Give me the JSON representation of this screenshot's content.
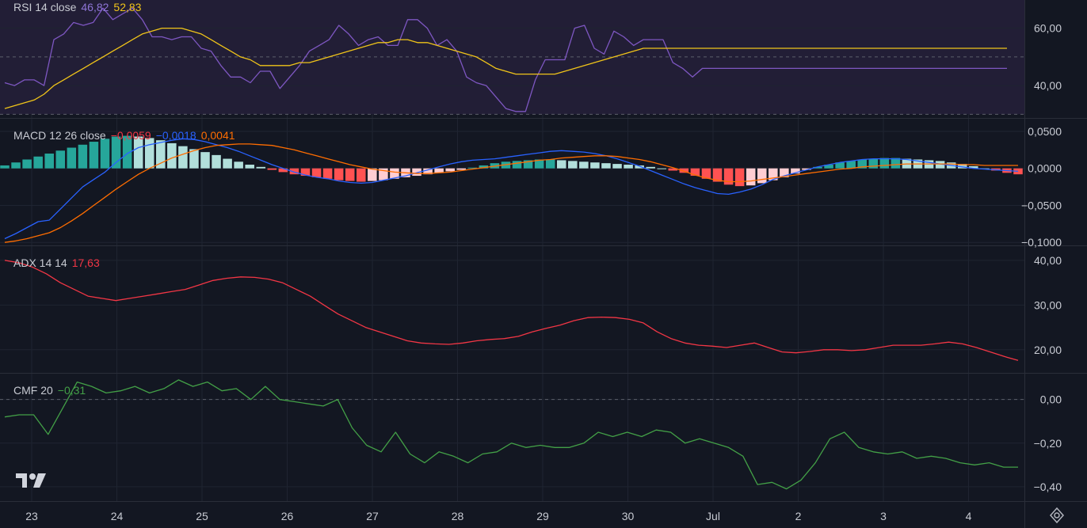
{
  "colors": {
    "background": "#131722",
    "grid": "#1f2431",
    "divider": "#2a2e39",
    "rsi_band": "#221e36",
    "rsi": "#7e57c2",
    "rsi_ma": "#f0c419",
    "macd": "#2962ff",
    "signal": "#ff6d00",
    "hist_pos_strong": "#26a69a",
    "hist_pos_weak": "#b2dfdb",
    "hist_neg_strong": "#ff5252",
    "hist_neg_weak": "#ffcdd2",
    "adx": "#f23645",
    "cmf": "#43a047",
    "dashed_level": "#5d606b"
  },
  "panes": {
    "rsi": {
      "name": "RSI 14 close",
      "v1": "46,82",
      "v2": "52,83"
    },
    "macd": {
      "name": "MACD 12 26 close",
      "v1": "−0,0059",
      "v2": "−0,0018",
      "v3": "0,0041"
    },
    "adx": {
      "name": "ADX 14 14",
      "v1": "17,63"
    },
    "cmf": {
      "name": "CMF 20",
      "v1": "−0,31"
    }
  },
  "icons": {
    "logo": "tradingview-logo",
    "settings": "gear-icon"
  },
  "chart_data": [
    {
      "type": "line",
      "pane": "RSI 14 close",
      "ylim": [
        29,
        69
      ],
      "bands": [
        30,
        70
      ],
      "midline": 50,
      "yticks": [
        40,
        60
      ],
      "ytick_labels": [
        "40,00",
        "60,00"
      ],
      "x": [
        0,
        1,
        2,
        3,
        4,
        5,
        6,
        7,
        8,
        9,
        10,
        11,
        12,
        13,
        14,
        15,
        16,
        17,
        18,
        19,
        20,
        21,
        22,
        23,
        24,
        25,
        26,
        27,
        28,
        29,
        30,
        31,
        32,
        33,
        34,
        35,
        36,
        37,
        38,
        39,
        40,
        41,
        42,
        43,
        44,
        45,
        46,
        47,
        48,
        49,
        50,
        51,
        52,
        53,
        54,
        55,
        56,
        57,
        58,
        59,
        60,
        61,
        62,
        63,
        64,
        65,
        66,
        67,
        68,
        69,
        70,
        71,
        72,
        73,
        74,
        75,
        76,
        77,
        78,
        79,
        80,
        81,
        82,
        83,
        84,
        85,
        86,
        87,
        88,
        89,
        90,
        91,
        92,
        93,
        94,
        95,
        96,
        97,
        98,
        99,
        100,
        101,
        102,
        103,
        104,
        105,
        106,
        107,
        108,
        109,
        110,
        111,
        112,
        113,
        114,
        115,
        116,
        117,
        118
      ],
      "series": [
        {
          "name": "RSI",
          "color": "#7e57c2",
          "values": [
            41,
            40,
            42,
            42,
            40,
            56,
            58,
            62,
            61,
            62,
            67,
            63,
            65,
            67,
            63,
            57,
            57,
            56,
            57,
            57,
            53,
            52,
            47,
            43,
            43,
            41,
            45,
            45,
            39,
            43,
            47,
            52,
            54,
            56,
            61,
            58,
            54,
            56,
            57,
            54,
            54,
            63,
            63,
            60,
            54,
            56,
            52,
            43,
            41,
            40,
            36,
            32,
            31,
            31,
            42,
            49,
            49,
            49,
            60,
            61,
            53,
            51,
            59,
            57,
            54,
            56,
            56,
            56,
            48,
            46,
            43,
            46,
            46,
            46,
            46,
            46,
            46,
            46,
            46,
            46,
            46,
            46,
            46,
            46,
            46,
            46,
            46,
            46,
            46,
            46,
            46,
            46,
            46,
            46,
            46,
            46,
            46,
            46,
            46,
            46,
            46,
            46,
            46,
            46,
            46,
            46,
            46,
            46,
            46,
            46,
            46,
            46,
            46,
            46,
            46,
            46,
            46,
            46,
            46
          ]
        },
        {
          "name": "RSI-based MA",
          "color": "#f0c419",
          "values": [
            32,
            33,
            34,
            35,
            37,
            40,
            42,
            44,
            46,
            48,
            50,
            52,
            54,
            56,
            58,
            59,
            60,
            60,
            60,
            59,
            58,
            56,
            54,
            52,
            50,
            49,
            47,
            47,
            47,
            47,
            48,
            48,
            49,
            50,
            51,
            52,
            53,
            54,
            55,
            55,
            56,
            56,
            55,
            55,
            54,
            53,
            52,
            51,
            50,
            48,
            46,
            45,
            44,
            44,
            44,
            44,
            44,
            45,
            46,
            47,
            48,
            49,
            50,
            51,
            52,
            53,
            53,
            53,
            53,
            53,
            53,
            53,
            53,
            53,
            53,
            53,
            53,
            53,
            53,
            53,
            53,
            53,
            53,
            53,
            53,
            53,
            53,
            53,
            53,
            53,
            53,
            53,
            53,
            53,
            53,
            53,
            53,
            53,
            53,
            53,
            53,
            53,
            53,
            53,
            53,
            53,
            53,
            53,
            53,
            53,
            53,
            53,
            53,
            53,
            53,
            53,
            53,
            53,
            53
          ]
        }
      ]
    },
    {
      "type": "bar",
      "pane": "MACD 12 26 close",
      "ylim": [
        -0.103,
        0.066
      ],
      "yticks": [
        0.05,
        0,
        -0.05,
        -0.1
      ],
      "ytick_labels": [
        "0,0500",
        "0,0000",
        "−0,0500",
        "−0,1000"
      ],
      "histogram": [
        0.004,
        0.008,
        0.012,
        0.016,
        0.02,
        0.024,
        0.028,
        0.032,
        0.036,
        0.04,
        0.043,
        0.044,
        0.043,
        0.041,
        0.038,
        0.034,
        0.03,
        0.026,
        0.022,
        0.018,
        0.013,
        0.009,
        0.005,
        0.002,
        -0.002,
        -0.005,
        -0.008,
        -0.01,
        -0.012,
        -0.014,
        -0.016,
        -0.017,
        -0.018,
        -0.017,
        -0.016,
        -0.014,
        -0.012,
        -0.01,
        -0.008,
        -0.006,
        -0.004,
        -0.002,
        0.001,
        0.004,
        0.007,
        0.009,
        0.01,
        0.011,
        0.012,
        0.012,
        0.011,
        0.01,
        0.009,
        0.008,
        0.007,
        0.006,
        0.005,
        0.004,
        0.002,
        0.0,
        -0.003,
        -0.006,
        -0.01,
        -0.014,
        -0.018,
        -0.022,
        -0.024,
        -0.023,
        -0.02,
        -0.016,
        -0.012,
        -0.007,
        -0.002,
        0.002,
        0.005,
        0.008,
        0.01,
        0.012,
        0.013,
        0.014,
        0.014,
        0.013,
        0.012,
        0.011,
        0.01,
        0.008,
        0.006,
        0.003,
        0.0,
        -0.003,
        -0.006,
        -0.008
      ],
      "series": [
        {
          "name": "MACD",
          "color": "#2962ff",
          "values": [
            -0.095,
            -0.088,
            -0.08,
            -0.072,
            -0.07,
            -0.055,
            -0.04,
            -0.025,
            -0.015,
            -0.005,
            0.008,
            0.02,
            0.028,
            0.032,
            0.035,
            0.038,
            0.04,
            0.039,
            0.036,
            0.032,
            0.028,
            0.023,
            0.017,
            0.011,
            0.005,
            0.0,
            -0.005,
            -0.009,
            -0.012,
            -0.014,
            -0.017,
            -0.019,
            -0.02,
            -0.019,
            -0.016,
            -0.013,
            -0.01,
            -0.006,
            -0.002,
            0.002,
            0.006,
            0.009,
            0.011,
            0.012,
            0.013,
            0.015,
            0.017,
            0.019,
            0.021,
            0.023,
            0.024,
            0.023,
            0.022,
            0.02,
            0.017,
            0.013,
            0.008,
            0.003,
            -0.003,
            -0.009,
            -0.015,
            -0.021,
            -0.026,
            -0.03,
            -0.034,
            -0.035,
            -0.032,
            -0.028,
            -0.022,
            -0.015,
            -0.01,
            -0.006,
            -0.002,
            0.002,
            0.005,
            0.008,
            0.01,
            0.012,
            0.013,
            0.013,
            0.013,
            0.012,
            0.01,
            0.008,
            0.006,
            0.004,
            0.002,
            0.0,
            -0.001,
            -0.002,
            -0.003,
            -0.004
          ]
        },
        {
          "name": "Signal",
          "color": "#ff6d00",
          "values": [
            -0.1,
            -0.098,
            -0.095,
            -0.091,
            -0.087,
            -0.08,
            -0.071,
            -0.061,
            -0.05,
            -0.039,
            -0.028,
            -0.018,
            -0.008,
            0.0,
            0.007,
            0.014,
            0.019,
            0.024,
            0.028,
            0.031,
            0.032,
            0.033,
            0.033,
            0.032,
            0.031,
            0.028,
            0.025,
            0.021,
            0.017,
            0.013,
            0.009,
            0.005,
            0.002,
            -0.001,
            -0.003,
            -0.005,
            -0.006,
            -0.007,
            -0.007,
            -0.006,
            -0.005,
            -0.003,
            -0.001,
            0.001,
            0.003,
            0.005,
            0.007,
            0.009,
            0.011,
            0.012,
            0.014,
            0.015,
            0.016,
            0.017,
            0.017,
            0.016,
            0.014,
            0.012,
            0.009,
            0.005,
            0.001,
            -0.004,
            -0.009,
            -0.013,
            -0.016,
            -0.018,
            -0.018,
            -0.017,
            -0.015,
            -0.013,
            -0.011,
            -0.009,
            -0.007,
            -0.005,
            -0.003,
            -0.001,
            0.0,
            0.002,
            0.003,
            0.004,
            0.005,
            0.006,
            0.006,
            0.006,
            0.006,
            0.006,
            0.005,
            0.005,
            0.004,
            0.004,
            0.004,
            0.004
          ]
        }
      ]
    },
    {
      "type": "line",
      "pane": "ADX 14 14",
      "ylim": [
        15,
        43
      ],
      "yticks": [
        20,
        30,
        40
      ],
      "ytick_labels": [
        "20,00",
        "30,00",
        "40,00"
      ],
      "series": [
        {
          "name": "ADX",
          "color": "#f23645",
          "values": [
            40,
            39.5,
            38.5,
            37,
            35,
            33.5,
            32,
            31.5,
            31,
            31.5,
            32,
            32.5,
            33,
            33.5,
            34.5,
            35.5,
            36,
            36.3,
            36.2,
            35.8,
            35,
            33.5,
            32,
            30,
            28,
            26.5,
            25,
            24,
            23,
            22,
            21.5,
            21.3,
            21.2,
            21.5,
            22,
            22.3,
            22.5,
            23,
            24,
            24.8,
            25.5,
            26.5,
            27.2,
            27.3,
            27.2,
            26.8,
            26,
            24,
            22.5,
            21.5,
            21,
            20.8,
            20.5,
            21,
            21.5,
            20.5,
            19.5,
            19.3,
            19.6,
            20,
            20,
            19.8,
            20,
            20.5,
            21,
            21,
            21,
            21.3,
            21.7,
            21.3,
            20.5,
            19.5,
            18.5,
            17.6
          ]
        }
      ]
    },
    {
      "type": "line",
      "pane": "CMF 20",
      "ylim": [
        -0.455,
        0.115
      ],
      "midline": 0,
      "yticks": [
        0,
        -0.2,
        -0.4
      ],
      "ytick_labels": [
        "0,00",
        "−0,20",
        "−0,40"
      ],
      "series": [
        {
          "name": "CMF",
          "color": "#43a047",
          "values": [
            -0.08,
            -0.07,
            -0.07,
            -0.16,
            -0.04,
            0.08,
            0.06,
            0.03,
            0.04,
            0.06,
            0.03,
            0.05,
            0.09,
            0.06,
            0.08,
            0.04,
            0.05,
            0.0,
            0.06,
            0.0,
            -0.01,
            -0.02,
            -0.03,
            0.0,
            -0.13,
            -0.21,
            -0.24,
            -0.15,
            -0.25,
            -0.29,
            -0.24,
            -0.26,
            -0.29,
            -0.25,
            -0.24,
            -0.2,
            -0.22,
            -0.21,
            -0.22,
            -0.22,
            -0.2,
            -0.15,
            -0.17,
            -0.15,
            -0.17,
            -0.14,
            -0.15,
            -0.2,
            -0.18,
            -0.2,
            -0.22,
            -0.26,
            -0.39,
            -0.38,
            -0.41,
            -0.37,
            -0.29,
            -0.18,
            -0.15,
            -0.22,
            -0.24,
            -0.25,
            -0.24,
            -0.27,
            -0.26,
            -0.27,
            -0.29,
            -0.3,
            -0.29,
            -0.31,
            -0.31
          ]
        }
      ]
    }
  ],
  "x_axis": {
    "labels": [
      "23",
      "24",
      "25",
      "26",
      "27",
      "28",
      "29",
      "30",
      "Jul",
      "2",
      "3",
      "4"
    ]
  }
}
